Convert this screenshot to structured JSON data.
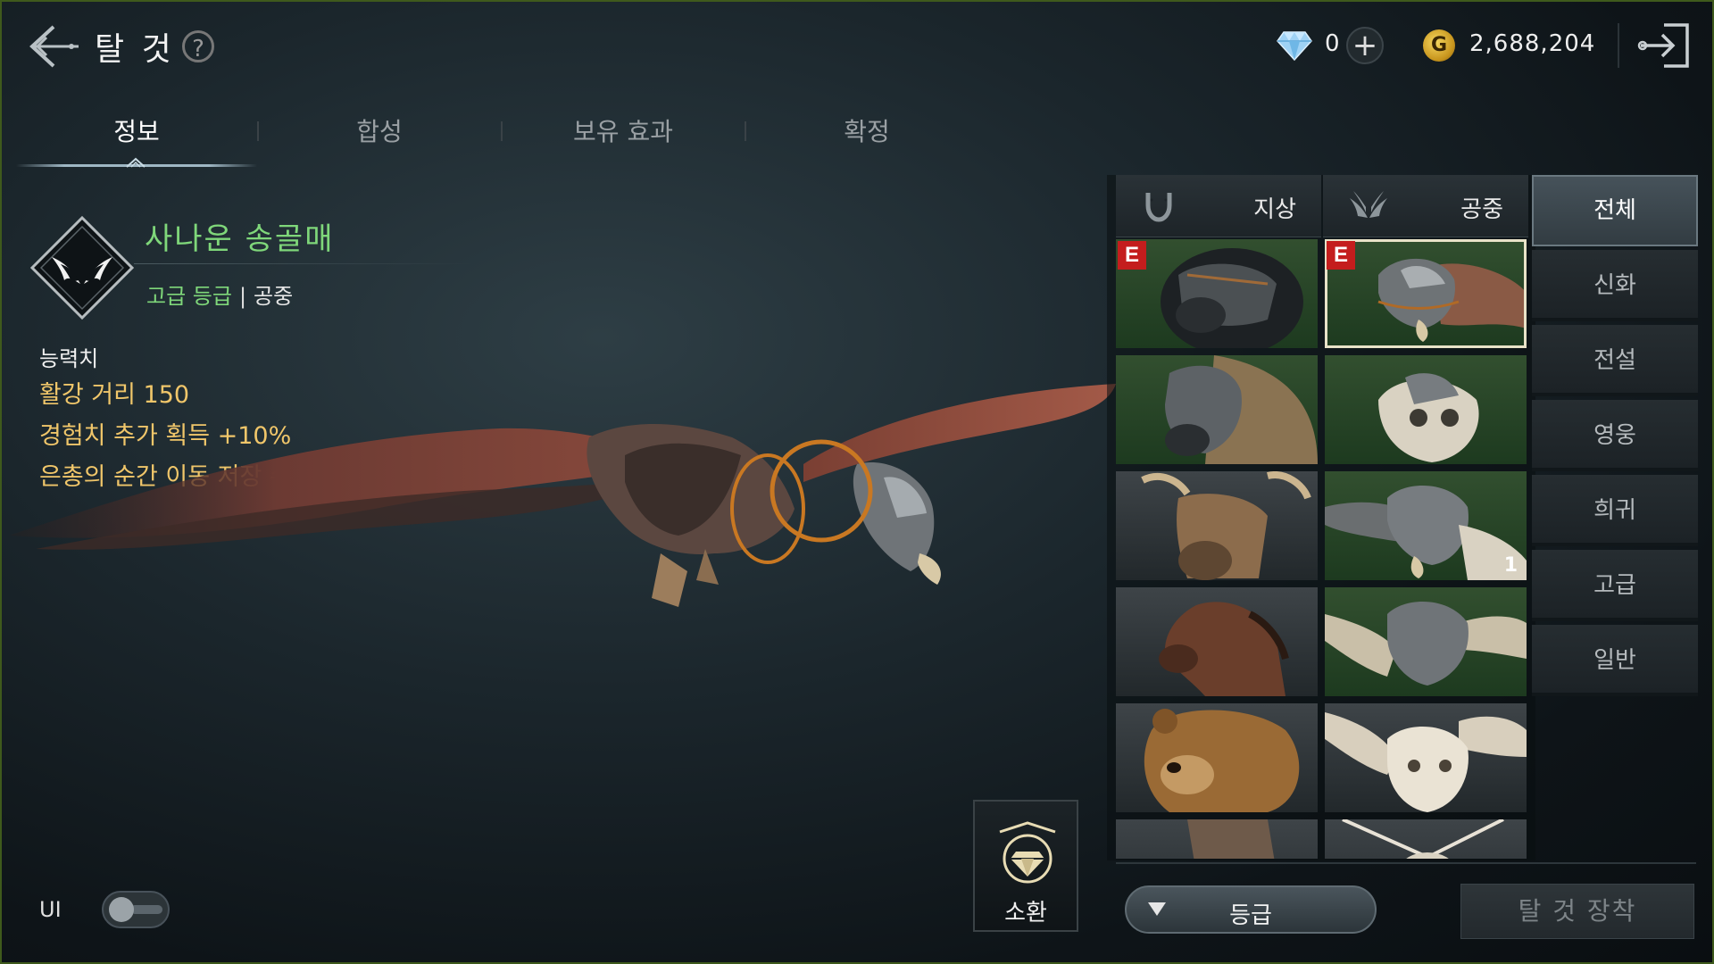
{
  "header": {
    "title": "탈 것",
    "help_symbol": "?",
    "diamond_count": "0",
    "plus_symbol": "+",
    "gold_symbol": "G",
    "gold_amount": "2,688,204"
  },
  "tabs": [
    {
      "label": "정보",
      "active": true
    },
    {
      "label": "합성",
      "active": false
    },
    {
      "label": "보유 효과",
      "active": false
    },
    {
      "label": "확정",
      "active": false
    }
  ],
  "mount": {
    "name": "사나운 송골매",
    "grade": "고급 등급",
    "separator": "|",
    "type": "공중",
    "stats_title": "능력치",
    "stats": [
      "활강 거리 150",
      "경험치 추가 획득 +10%",
      "은총의 순간 이동 저장 수 2"
    ]
  },
  "summon": {
    "label": "소환"
  },
  "ui_toggle": {
    "label": "UI",
    "on": false
  },
  "category_tabs": [
    {
      "label": "지상",
      "icon": "horseshoe-icon"
    },
    {
      "label": "공중",
      "icon": "wings-icon"
    }
  ],
  "grid": {
    "equipped_mark": "E",
    "cells": [
      {
        "creature": "armored-black-panther",
        "equipped": true,
        "selected": false,
        "count": ""
      },
      {
        "creature": "armored-eagle",
        "equipped": true,
        "selected": true,
        "count": ""
      },
      {
        "creature": "armored-beast",
        "equipped": false,
        "selected": false,
        "count": ""
      },
      {
        "creature": "armored-owl",
        "equipped": false,
        "selected": false,
        "count": ""
      },
      {
        "creature": "elk",
        "equipped": false,
        "selected": false,
        "count": ""
      },
      {
        "creature": "armored-eagle",
        "equipped": false,
        "selected": false,
        "count": "1"
      },
      {
        "creature": "brown-horse",
        "equipped": false,
        "selected": false,
        "count": ""
      },
      {
        "creature": "armored-owl",
        "equipped": false,
        "selected": false,
        "count": ""
      },
      {
        "creature": "brown-bear",
        "equipped": false,
        "selected": false,
        "count": ""
      },
      {
        "creature": "white-owl",
        "equipped": false,
        "selected": false,
        "count": ""
      },
      {
        "creature": "horse",
        "equipped": false,
        "selected": false,
        "count": ""
      },
      {
        "creature": "white-bird",
        "equipped": false,
        "selected": false,
        "count": ""
      }
    ]
  },
  "grade_filters": [
    {
      "label": "전체",
      "active": true
    },
    {
      "label": "신화",
      "active": false
    },
    {
      "label": "전설",
      "active": false
    },
    {
      "label": "영웅",
      "active": false
    },
    {
      "label": "희귀",
      "active": false
    },
    {
      "label": "고급",
      "active": false
    },
    {
      "label": "일반",
      "active": false
    }
  ],
  "sort_button": {
    "label": "등급"
  },
  "equip_button": {
    "label": "탈 것 장착"
  },
  "colors": {
    "grade_green": "#7fd77a",
    "stat_gold": "#f0c66a",
    "equipped_red": "#c41d1d"
  }
}
